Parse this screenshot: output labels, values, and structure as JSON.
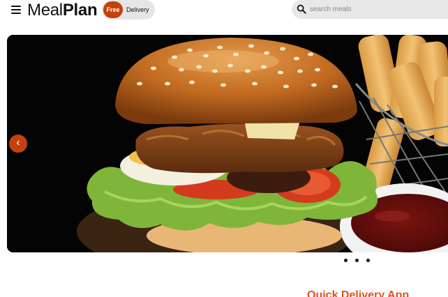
{
  "header": {
    "menu_icon": "hamburger-menu-icon",
    "logo": {
      "light": "Meal",
      "bold": "Plan"
    },
    "delivery_badge": {
      "pill": "Free",
      "text": "Delivery"
    },
    "search": {
      "placeholder": "search meals",
      "icon": "search-icon"
    }
  },
  "hero": {
    "image_subject": "burger with fries and ketchup",
    "prev_label": "‹",
    "slide_count": 3,
    "active_slide": 1
  },
  "promo": {
    "heading": "Quick Delivery App"
  },
  "colors": {
    "accent": "#c2410c",
    "heading_orange": "#e8501c",
    "pill_bg": "#e6e6e6"
  }
}
